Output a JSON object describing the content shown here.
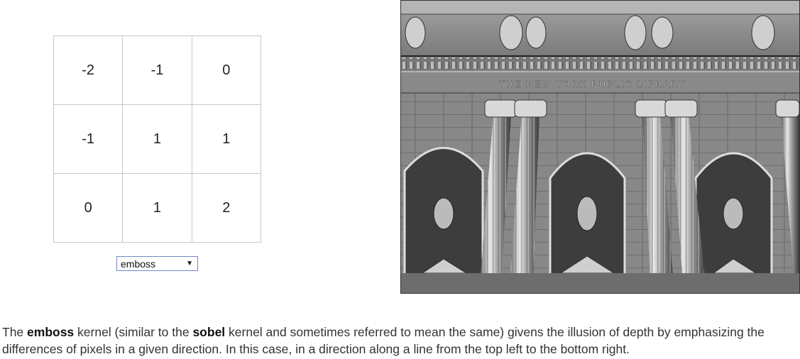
{
  "kernel": {
    "cells": [
      [
        "-2",
        "-1",
        "0"
      ],
      [
        "-1",
        "1",
        "1"
      ],
      [
        "0",
        "1",
        "2"
      ]
    ]
  },
  "selector": {
    "selected": "emboss"
  },
  "photo": {
    "sign_text": "THE NEW YORK PUBLIC LIBRARY"
  },
  "caption": {
    "part1": "The ",
    "term1": "emboss",
    "part2": " kernel (similar to the ",
    "term2": "sobel",
    "part3": " kernel and sometimes referred to mean the same) givens the illusion of depth by emphasizing the differences of pixels in a given direction. In this case, in a direction along a line from the top left to the bottom right."
  }
}
